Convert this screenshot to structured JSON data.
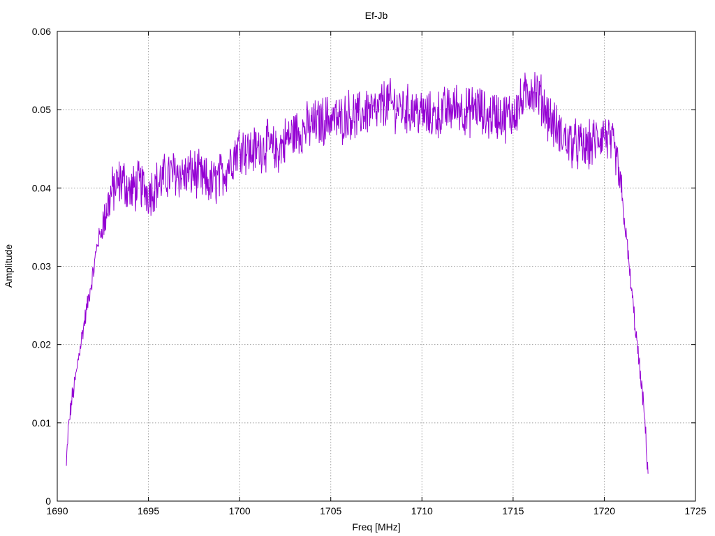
{
  "chart_data": {
    "type": "line",
    "title": "Ef-Jb",
    "xlabel": "Freq [MHz]",
    "ylabel": "Amplitude",
    "xlim": [
      1690,
      1725
    ],
    "ylim": [
      0,
      0.06
    ],
    "x_ticks": [
      1690,
      1695,
      1700,
      1705,
      1710,
      1715,
      1720,
      1725
    ],
    "y_ticks": [
      0,
      0.01,
      0.02,
      0.03,
      0.04,
      0.05,
      0.06
    ],
    "x_tick_labels": [
      "1690",
      "1695",
      "1700",
      "1705",
      "1710",
      "1715",
      "1720",
      "1725"
    ],
    "y_tick_labels": [
      "0",
      "0.01",
      "0.02",
      "0.03",
      "0.04",
      "0.05",
      "0.06"
    ],
    "grid": true,
    "series": [
      {
        "color": "#9400d3",
        "x": [
          1690.5,
          1690.6,
          1690.8,
          1691.0,
          1691.2,
          1691.5,
          1691.8,
          1692.0,
          1692.2,
          1692.5,
          1692.8,
          1693.0,
          1693.3,
          1693.6,
          1694.0,
          1694.5,
          1695.0,
          1695.5,
          1696.0,
          1696.5,
          1697.0,
          1697.5,
          1698.0,
          1698.5,
          1699.0,
          1699.5,
          1700.0,
          1700.5,
          1701.0,
          1701.5,
          1702.0,
          1702.5,
          1703.0,
          1703.5,
          1704.0,
          1704.5,
          1705.0,
          1705.5,
          1706.0,
          1706.5,
          1707.0,
          1707.5,
          1708.0,
          1708.5,
          1709.0,
          1709.5,
          1710.0,
          1710.5,
          1711.0,
          1711.5,
          1712.0,
          1712.5,
          1713.0,
          1713.5,
          1714.0,
          1714.5,
          1715.0,
          1715.5,
          1716.0,
          1716.5,
          1717.0,
          1717.5,
          1718.0,
          1718.5,
          1719.0,
          1719.5,
          1720.0,
          1720.5,
          1720.8,
          1721.0,
          1721.2,
          1721.4,
          1721.6,
          1721.8,
          1722.0,
          1722.2,
          1722.4
        ],
        "values": [
          0.0045,
          0.009,
          0.013,
          0.0155,
          0.019,
          0.023,
          0.027,
          0.0295,
          0.033,
          0.035,
          0.038,
          0.0395,
          0.0405,
          0.041,
          0.0395,
          0.0405,
          0.0395,
          0.0405,
          0.0415,
          0.042,
          0.0415,
          0.042,
          0.041,
          0.0405,
          0.0415,
          0.0435,
          0.0455,
          0.0445,
          0.045,
          0.0455,
          0.0445,
          0.046,
          0.047,
          0.0475,
          0.048,
          0.0485,
          0.049,
          0.0485,
          0.0495,
          0.049,
          0.05,
          0.0495,
          0.051,
          0.0505,
          0.05,
          0.05,
          0.0495,
          0.049,
          0.0495,
          0.05,
          0.0505,
          0.0495,
          0.0505,
          0.049,
          0.0495,
          0.049,
          0.0495,
          0.051,
          0.053,
          0.0515,
          0.049,
          0.047,
          0.046,
          0.0455,
          0.045,
          0.046,
          0.047,
          0.045,
          0.042,
          0.038,
          0.034,
          0.029,
          0.0245,
          0.02,
          0.0155,
          0.011,
          0.0035
        ]
      }
    ]
  }
}
